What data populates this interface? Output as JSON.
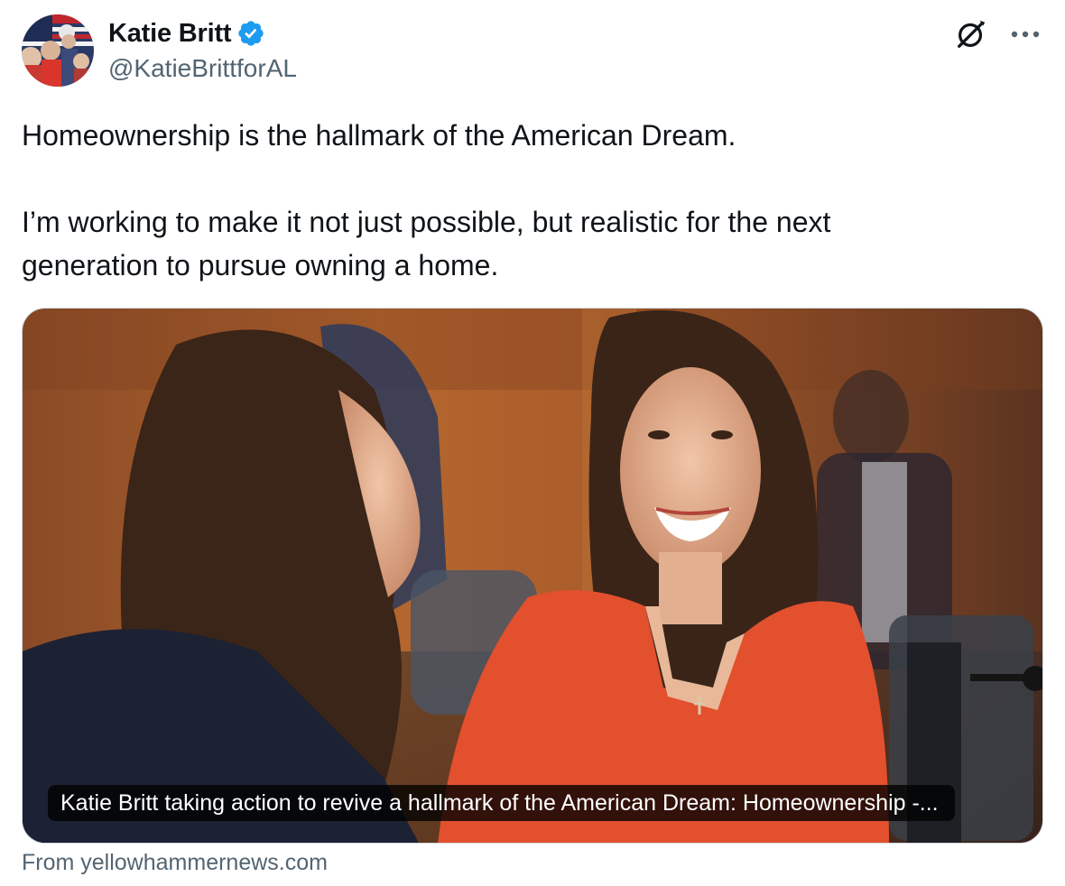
{
  "author": {
    "display_name": "Katie Britt",
    "handle": "@KatieBrittforAL",
    "verified": true,
    "verified_color": "#1d9bf0"
  },
  "tweet": {
    "paragraph_1": "Homeownership is the hallmark of the American Dream.",
    "paragraph_2_line_1": "I’m working to make it not just possible, but realistic for the next",
    "paragraph_2_line_2": "generation to pursue owning a home."
  },
  "card": {
    "caption": "Katie Britt taking action to revive a hallmark of the American Dream: Homeownership -...",
    "source": "From yellowhammernews.com"
  },
  "icons": {
    "grok": "grok-icon",
    "more": "more-icon",
    "verified": "verified-badge-icon"
  },
  "colors": {
    "text_primary": "#0f1419",
    "text_secondary": "#536471",
    "border": "#cfd9de"
  }
}
